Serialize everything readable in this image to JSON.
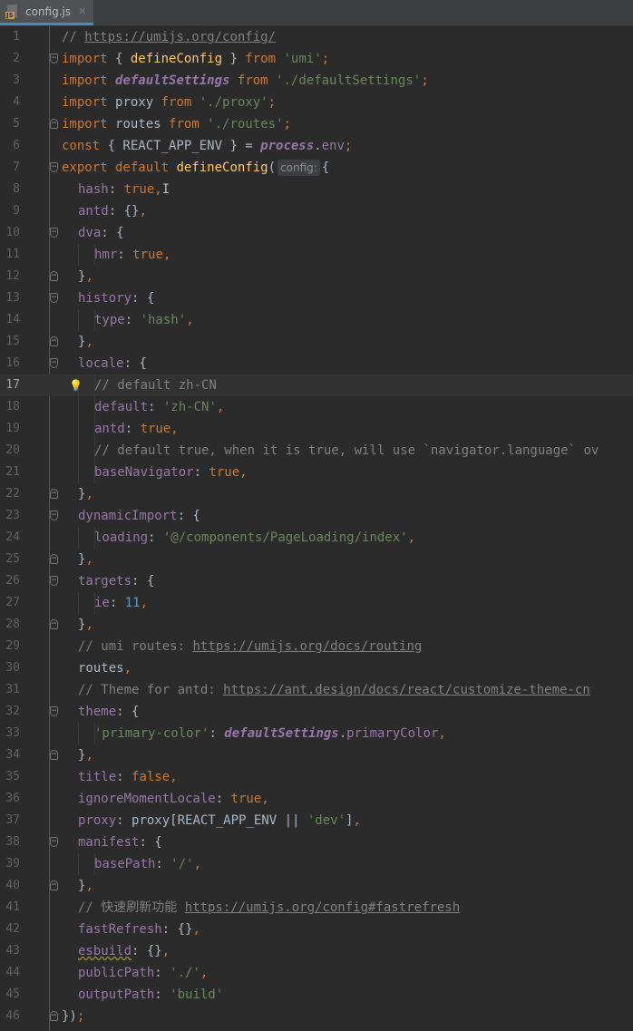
{
  "tab": {
    "filename": "config.js",
    "icon": "js-file-icon",
    "icon_label": "JS"
  },
  "editor": {
    "current_line": 17,
    "lines": [
      {
        "n": 1,
        "indent": 0,
        "tokens": [
          [
            "c-cmt",
            "// "
          ],
          [
            "c-link",
            "https://umijs.org/config/"
          ]
        ]
      },
      {
        "n": 2,
        "indent": 0,
        "fold": "open",
        "tokens": [
          [
            "c-kw",
            "import "
          ],
          [
            "c-id",
            "{ "
          ],
          [
            "c-fn",
            "defineConfig"
          ],
          [
            "c-id",
            " } "
          ],
          [
            "c-kw",
            "from "
          ],
          [
            "c-str",
            "'umi'"
          ],
          [
            "c-kw",
            ";"
          ]
        ]
      },
      {
        "n": 3,
        "indent": 0,
        "tokens": [
          [
            "c-kw",
            "import "
          ],
          [
            "c-glob",
            "defaultSettings"
          ],
          [
            "c-id",
            " "
          ],
          [
            "c-kw",
            "from "
          ],
          [
            "c-str",
            "'./defaultSettings'"
          ],
          [
            "c-kw",
            ";"
          ]
        ]
      },
      {
        "n": 4,
        "indent": 0,
        "tokens": [
          [
            "c-kw",
            "import "
          ],
          [
            "c-id",
            "proxy "
          ],
          [
            "c-kw",
            "from "
          ],
          [
            "c-str",
            "'./proxy'"
          ],
          [
            "c-kw",
            ";"
          ]
        ]
      },
      {
        "n": 5,
        "indent": 0,
        "fold": "close",
        "tokens": [
          [
            "c-kw",
            "import "
          ],
          [
            "c-id",
            "routes "
          ],
          [
            "c-kw",
            "from "
          ],
          [
            "c-str",
            "'./routes'"
          ],
          [
            "c-kw",
            ";"
          ]
        ]
      },
      {
        "n": 6,
        "indent": 0,
        "tokens": [
          [
            "c-kw",
            "const "
          ],
          [
            "c-id",
            "{ REACT_APP_ENV } = "
          ],
          [
            "c-glob",
            "process"
          ],
          [
            "c-id",
            "."
          ],
          [
            "c-prop",
            "env"
          ],
          [
            "c-kw",
            ";"
          ]
        ]
      },
      {
        "n": 7,
        "indent": 0,
        "fold": "open",
        "tokens": [
          [
            "c-kw",
            "export default "
          ],
          [
            "c-fn",
            "defineConfig"
          ],
          [
            "c-id",
            "("
          ],
          [
            "c-hint",
            "config:"
          ],
          [
            "c-id",
            "{"
          ]
        ]
      },
      {
        "n": 8,
        "indent": 1,
        "tokens": [
          [
            "c-prop",
            "hash"
          ],
          [
            "c-id",
            ": "
          ],
          [
            "c-kw",
            "true,"
          ],
          [
            "cursor",
            "I"
          ]
        ]
      },
      {
        "n": 9,
        "indent": 1,
        "tokens": [
          [
            "c-prop",
            "antd"
          ],
          [
            "c-id",
            ": {}"
          ],
          [
            "c-kw",
            ","
          ]
        ]
      },
      {
        "n": 10,
        "indent": 1,
        "fold": "open",
        "tokens": [
          [
            "c-prop",
            "dva"
          ],
          [
            "c-id",
            ": {"
          ]
        ]
      },
      {
        "n": 11,
        "indent": 2,
        "tokens": [
          [
            "c-prop",
            "hmr"
          ],
          [
            "c-id",
            ": "
          ],
          [
            "c-kw",
            "true,"
          ]
        ]
      },
      {
        "n": 12,
        "indent": 1,
        "fold": "close",
        "tokens": [
          [
            "c-id",
            "}"
          ],
          [
            "c-kw",
            ","
          ]
        ]
      },
      {
        "n": 13,
        "indent": 1,
        "fold": "open",
        "tokens": [
          [
            "c-prop",
            "history"
          ],
          [
            "c-id",
            ": {"
          ]
        ]
      },
      {
        "n": 14,
        "indent": 2,
        "tokens": [
          [
            "c-prop",
            "type"
          ],
          [
            "c-id",
            ": "
          ],
          [
            "c-str",
            "'hash'"
          ],
          [
            "c-kw",
            ","
          ]
        ]
      },
      {
        "n": 15,
        "indent": 1,
        "fold": "close",
        "tokens": [
          [
            "c-id",
            "}"
          ],
          [
            "c-kw",
            ","
          ]
        ]
      },
      {
        "n": 16,
        "indent": 1,
        "fold": "open",
        "tokens": [
          [
            "c-prop",
            "locale"
          ],
          [
            "c-id",
            ": {"
          ]
        ]
      },
      {
        "n": 17,
        "indent": 2,
        "bulb": true,
        "tokens": [
          [
            "c-cmt",
            "// default zh-CN"
          ]
        ]
      },
      {
        "n": 18,
        "indent": 2,
        "tokens": [
          [
            "c-prop",
            "default"
          ],
          [
            "c-id",
            ": "
          ],
          [
            "c-str",
            "'zh-CN'"
          ],
          [
            "c-kw",
            ","
          ]
        ]
      },
      {
        "n": 19,
        "indent": 2,
        "tokens": [
          [
            "c-prop",
            "antd"
          ],
          [
            "c-id",
            ": "
          ],
          [
            "c-kw",
            "true,"
          ]
        ]
      },
      {
        "n": 20,
        "indent": 2,
        "tokens": [
          [
            "c-cmt",
            "// default true, when it is true, will use `navigator.language` ov"
          ]
        ]
      },
      {
        "n": 21,
        "indent": 2,
        "tokens": [
          [
            "c-prop",
            "baseNavigator"
          ],
          [
            "c-id",
            ": "
          ],
          [
            "c-kw",
            "true,"
          ]
        ]
      },
      {
        "n": 22,
        "indent": 1,
        "fold": "close",
        "tokens": [
          [
            "c-id",
            "}"
          ],
          [
            "c-kw",
            ","
          ]
        ]
      },
      {
        "n": 23,
        "indent": 1,
        "fold": "open",
        "tokens": [
          [
            "c-prop",
            "dynamicImport"
          ],
          [
            "c-id",
            ": {"
          ]
        ]
      },
      {
        "n": 24,
        "indent": 2,
        "tokens": [
          [
            "c-prop",
            "loading"
          ],
          [
            "c-id",
            ": "
          ],
          [
            "c-str",
            "'@/components/PageLoading/index'"
          ],
          [
            "c-kw",
            ","
          ]
        ]
      },
      {
        "n": 25,
        "indent": 1,
        "fold": "close",
        "tokens": [
          [
            "c-id",
            "}"
          ],
          [
            "c-kw",
            ","
          ]
        ]
      },
      {
        "n": 26,
        "indent": 1,
        "fold": "open",
        "tokens": [
          [
            "c-prop",
            "targets"
          ],
          [
            "c-id",
            ": {"
          ]
        ]
      },
      {
        "n": 27,
        "indent": 2,
        "tokens": [
          [
            "c-prop",
            "ie"
          ],
          [
            "c-id",
            ": "
          ],
          [
            "c-num",
            "11"
          ],
          [
            "c-kw",
            ","
          ]
        ]
      },
      {
        "n": 28,
        "indent": 1,
        "fold": "close",
        "tokens": [
          [
            "c-id",
            "}"
          ],
          [
            "c-kw",
            ","
          ]
        ]
      },
      {
        "n": 29,
        "indent": 1,
        "tokens": [
          [
            "c-cmt",
            "// umi routes: "
          ],
          [
            "c-link",
            "https://umijs.org/docs/routing"
          ]
        ]
      },
      {
        "n": 30,
        "indent": 1,
        "tokens": [
          [
            "c-id",
            "routes"
          ],
          [
            "c-kw",
            ","
          ]
        ]
      },
      {
        "n": 31,
        "indent": 1,
        "tokens": [
          [
            "c-cmt",
            "// Theme for antd: "
          ],
          [
            "c-link",
            "https://ant.design/docs/react/customize-theme-cn"
          ]
        ]
      },
      {
        "n": 32,
        "indent": 1,
        "fold": "open",
        "tokens": [
          [
            "c-prop",
            "theme"
          ],
          [
            "c-id",
            ": {"
          ]
        ]
      },
      {
        "n": 33,
        "indent": 2,
        "tokens": [
          [
            "c-str",
            "'primary-color'"
          ],
          [
            "c-id",
            ": "
          ],
          [
            "c-obj",
            "defaultSettings"
          ],
          [
            "c-id",
            "."
          ],
          [
            "c-prop",
            "primaryColor"
          ],
          [
            "c-kw",
            ","
          ]
        ]
      },
      {
        "n": 34,
        "indent": 1,
        "fold": "close",
        "tokens": [
          [
            "c-id",
            "}"
          ],
          [
            "c-kw",
            ","
          ]
        ]
      },
      {
        "n": 35,
        "indent": 1,
        "tokens": [
          [
            "c-prop",
            "title"
          ],
          [
            "c-id",
            ": "
          ],
          [
            "c-kw",
            "false,"
          ]
        ]
      },
      {
        "n": 36,
        "indent": 1,
        "tokens": [
          [
            "c-prop",
            "ignoreMomentLocale"
          ],
          [
            "c-id",
            ": "
          ],
          [
            "c-kw",
            "true,"
          ]
        ]
      },
      {
        "n": 37,
        "indent": 1,
        "tokens": [
          [
            "c-prop",
            "proxy"
          ],
          [
            "c-id",
            ": proxy[REACT_APP_ENV || "
          ],
          [
            "c-str",
            "'dev'"
          ],
          [
            "c-id",
            "]"
          ],
          [
            "c-kw",
            ","
          ]
        ]
      },
      {
        "n": 38,
        "indent": 1,
        "fold": "open",
        "tokens": [
          [
            "c-prop",
            "manifest"
          ],
          [
            "c-id",
            ": {"
          ]
        ]
      },
      {
        "n": 39,
        "indent": 2,
        "tokens": [
          [
            "c-prop",
            "basePath"
          ],
          [
            "c-id",
            ": "
          ],
          [
            "c-str",
            "'/'"
          ],
          [
            "c-kw",
            ","
          ]
        ]
      },
      {
        "n": 40,
        "indent": 1,
        "fold": "close",
        "tokens": [
          [
            "c-id",
            "}"
          ],
          [
            "c-kw",
            ","
          ]
        ]
      },
      {
        "n": 41,
        "indent": 1,
        "tokens": [
          [
            "c-cmt",
            "// 快速刷新功能 "
          ],
          [
            "c-link",
            "https://umijs.org/config#fastrefresh"
          ]
        ]
      },
      {
        "n": 42,
        "indent": 1,
        "tokens": [
          [
            "c-prop",
            "fastRefresh"
          ],
          [
            "c-id",
            ": {}"
          ],
          [
            "c-kw",
            ","
          ]
        ]
      },
      {
        "n": 43,
        "indent": 1,
        "tokens": [
          [
            "c-prop c-warn",
            "esbuild"
          ],
          [
            "c-id",
            ": {}"
          ],
          [
            "c-kw",
            ","
          ]
        ]
      },
      {
        "n": 44,
        "indent": 1,
        "tokens": [
          [
            "c-prop",
            "publicPath"
          ],
          [
            "c-id",
            ": "
          ],
          [
            "c-str",
            "'./'"
          ],
          [
            "c-kw",
            ","
          ]
        ]
      },
      {
        "n": 45,
        "indent": 1,
        "tokens": [
          [
            "c-prop",
            "outputPath"
          ],
          [
            "c-id",
            ": "
          ],
          [
            "c-str",
            "'build'"
          ]
        ]
      },
      {
        "n": 46,
        "indent": 0,
        "fold": "close",
        "tokens": [
          [
            "c-id",
            "})"
          ],
          [
            "c-kw",
            ";"
          ]
        ]
      }
    ]
  }
}
